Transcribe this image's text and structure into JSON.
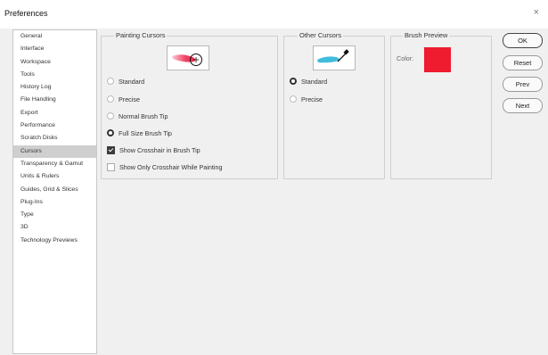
{
  "window": {
    "title": "Preferences",
    "close": "×"
  },
  "sidebar": {
    "items": [
      {
        "label": "General",
        "selected": false
      },
      {
        "label": "Interface",
        "selected": false
      },
      {
        "label": "Workspace",
        "selected": false
      },
      {
        "label": "Tools",
        "selected": false
      },
      {
        "label": "History Log",
        "selected": false
      },
      {
        "label": "File Handling",
        "selected": false
      },
      {
        "label": "Export",
        "selected": false
      },
      {
        "label": "Performance",
        "selected": false
      },
      {
        "label": "Scratch Disks",
        "selected": false
      },
      {
        "label": "Cursors",
        "selected": true
      },
      {
        "label": "Transparency & Gamut",
        "selected": false
      },
      {
        "label": "Units & Rulers",
        "selected": false
      },
      {
        "label": "Guides, Grid & Slices",
        "selected": false
      },
      {
        "label": "Plug-Ins",
        "selected": false
      },
      {
        "label": "Type",
        "selected": false
      },
      {
        "label": "3D",
        "selected": false
      },
      {
        "label": "Technology Previews",
        "selected": false
      }
    ]
  },
  "painting_cursors": {
    "title": "Painting Cursors",
    "options": {
      "standard": {
        "label": "Standard",
        "checked": false
      },
      "precise": {
        "label": "Precise",
        "checked": false
      },
      "normal_brush_tip": {
        "label": "Normal Brush Tip",
        "checked": false
      },
      "full_size_brush_tip": {
        "label": "Full Size Brush Tip",
        "checked": true
      },
      "show_crosshair": {
        "label": "Show Crosshair in Brush Tip",
        "checked": true
      },
      "show_only_crosshair": {
        "label": "Show Only Crosshair While Painting",
        "checked": false
      }
    },
    "stroke_color": "#ee2a4d"
  },
  "other_cursors": {
    "title": "Other Cursors",
    "options": {
      "standard": {
        "label": "Standard",
        "checked": true
      },
      "precise": {
        "label": "Precise",
        "checked": false
      }
    },
    "stroke_color": "#2bb5d8"
  },
  "brush_preview": {
    "title": "Brush Preview",
    "color_label": "Color:",
    "color": "#ee1c2e"
  },
  "buttons": {
    "ok": "OK",
    "reset": "Reset",
    "prev": "Prev",
    "next": "Next"
  }
}
